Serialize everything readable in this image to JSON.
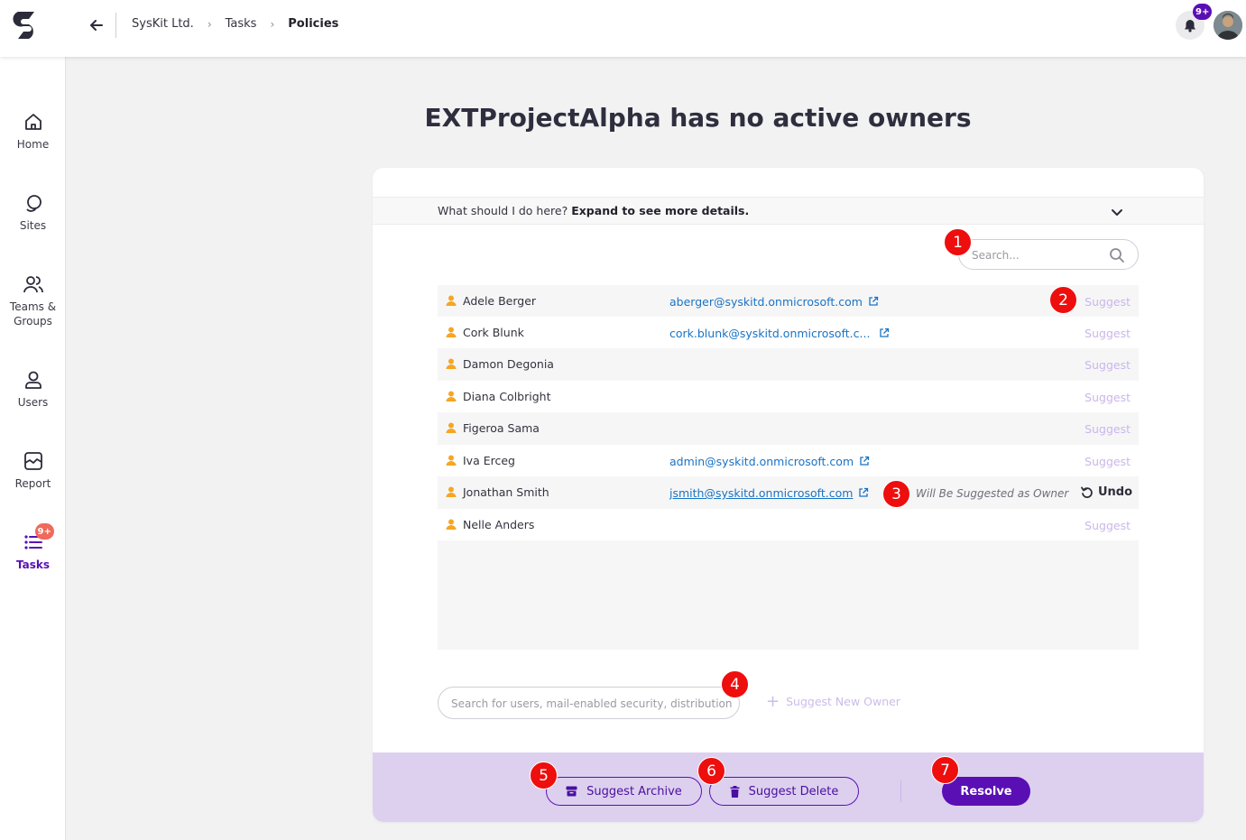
{
  "header": {
    "breadcrumb": [
      "SysKit Ltd.",
      "Tasks",
      "Policies"
    ],
    "notification_count": "9+"
  },
  "sidebar": {
    "items": [
      {
        "label": "Home",
        "icon": "home-icon"
      },
      {
        "label": "Sites",
        "icon": "sites-icon"
      },
      {
        "label": "Teams &\nGroups",
        "icon": "teams-icon"
      },
      {
        "label": "Users",
        "icon": "user-icon"
      },
      {
        "label": "Report",
        "icon": "report-icon"
      },
      {
        "label": "Tasks",
        "icon": "tasks-icon",
        "badge": "9+",
        "active": true
      }
    ]
  },
  "main": {
    "title": "EXTProjectAlpha has no active owners",
    "expander": {
      "prefix": "What should I do here? ",
      "bold": "Expand to see more details."
    },
    "search_placeholder": "Search...",
    "rows": [
      {
        "name": "Adele Berger",
        "email": "aberger@syskitd.onmicrosoft.com",
        "action": "Suggest"
      },
      {
        "name": "Cork Blunk",
        "email": "cork.blunk@syskitd.onmicrosoft.c...",
        "action": "Suggest"
      },
      {
        "name": "Damon Degonia",
        "email": "",
        "action": "Suggest"
      },
      {
        "name": "Diana Colbright",
        "email": "",
        "action": "Suggest"
      },
      {
        "name": "Figeroa Sama",
        "email": "",
        "action": "Suggest"
      },
      {
        "name": "Iva Erceg",
        "email": "admin@syskitd.onmicrosoft.com",
        "action": "Suggest"
      },
      {
        "name": "Jonathan Smith",
        "email": "jsmith@syskitd.onmicrosoft.com",
        "status": "Will Be Suggested as Owner",
        "action": "Undo"
      },
      {
        "name": "Nelle Anders",
        "email": "",
        "action": "Suggest"
      }
    ],
    "owner_search_placeholder": "Search for users, mail-enabled security, distribution, ...",
    "suggest_new_owner": "Suggest New Owner"
  },
  "footer": {
    "archive": "Suggest Archive",
    "delete": "Suggest Delete",
    "resolve": "Resolve"
  },
  "markers": [
    "1",
    "2",
    "3",
    "4",
    "5",
    "6",
    "7"
  ],
  "colors": {
    "brand": "#5a0fb5",
    "link": "#1a73c4",
    "user_icon": "#f5a623",
    "marker": "#ee0e0e",
    "footer_bg": "#ddd0ef"
  }
}
